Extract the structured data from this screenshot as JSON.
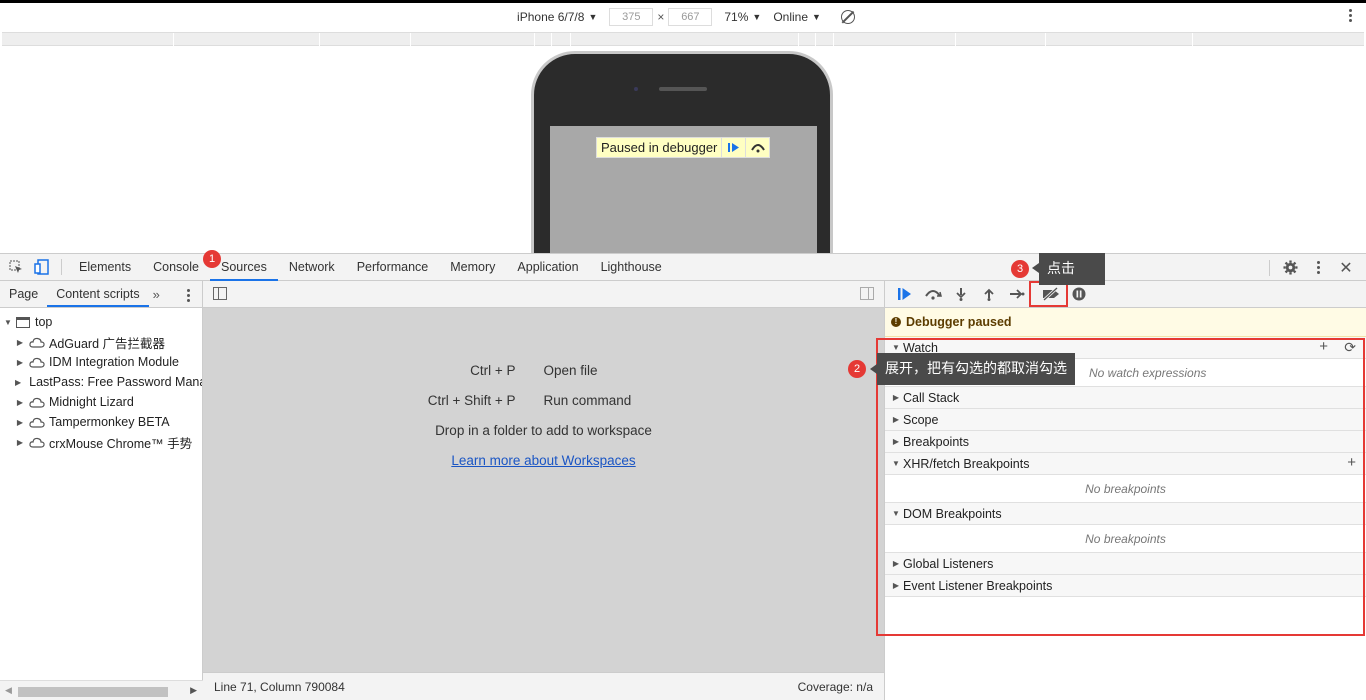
{
  "device_toolbar": {
    "device": "iPhone 6/7/8",
    "width": "375",
    "height": "667",
    "times": "×",
    "zoom": "71%",
    "throttle": "Online"
  },
  "viewport": {
    "paused_banner": "Paused in debugger"
  },
  "devtools": {
    "tabs": [
      "Elements",
      "Console",
      "Sources",
      "Network",
      "Performance",
      "Memory",
      "Application",
      "Lighthouse"
    ],
    "active_tab": "Sources"
  },
  "navigator": {
    "tabs": [
      "Page",
      "Content scripts"
    ],
    "more": "»",
    "root": "top",
    "items": [
      "AdGuard 广告拦截器",
      "IDM Integration Module",
      "LastPass: Free Password Mana",
      "Midnight Lizard",
      "Tampermonkey BETA",
      "crxMouse Chrome™ 手势"
    ]
  },
  "editor": {
    "shortcuts": [
      {
        "key": "Ctrl + P",
        "action": "Open file"
      },
      {
        "key": "Ctrl + Shift + P",
        "action": "Run command"
      }
    ],
    "drop_hint": "Drop in a folder to add to workspace",
    "learn_link": "Learn more about Workspaces",
    "status_left": "Line 71, Column 790084",
    "status_right": "Coverage: n/a"
  },
  "debugger": {
    "paused_text": "Debugger paused",
    "watch": {
      "label": "Watch",
      "placeholder": "No watch expressions"
    },
    "call_stack": "Call Stack",
    "scope": "Scope",
    "breakpoints": "Breakpoints",
    "xhr": {
      "label": "XHR/fetch Breakpoints",
      "empty": "No breakpoints"
    },
    "dom": {
      "label": "DOM Breakpoints",
      "empty": "No breakpoints"
    },
    "global_listeners": "Global Listeners",
    "event_listener_breakpoints": "Event Listener Breakpoints"
  },
  "annotations": {
    "badge1": "1",
    "badge2": "2",
    "badge3": "3",
    "callout2": "展开，把有勾选的都取消勾选",
    "callout3": "点击",
    "accent": "#e53935"
  },
  "colors": {
    "accent_blue": "#1a73e8",
    "paused_bg": "#fffbe5",
    "editor_bg": "#d3d3d3"
  }
}
